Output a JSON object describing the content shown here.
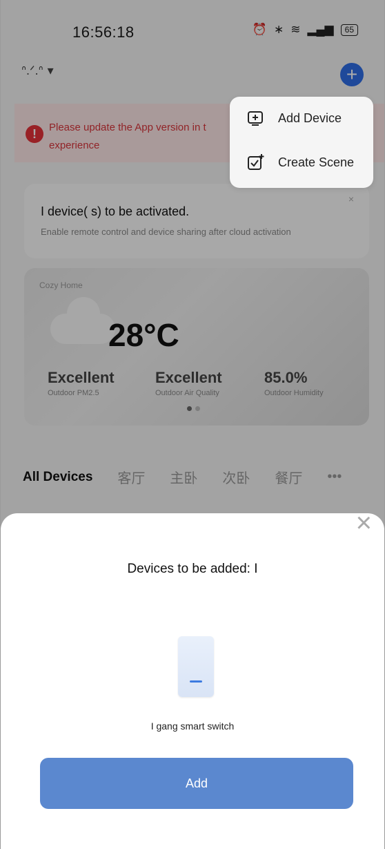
{
  "status_bar": {
    "time": "16:56:18",
    "battery": "65"
  },
  "header": {
    "home_name": "ᐢ.ᐟ.ᐢ"
  },
  "banner": {
    "text": "Please update the App version in t experience"
  },
  "activation_card": {
    "title": "I device( s)  to be activated.",
    "description": "Enable remote control and device sharing after cloud activation"
  },
  "weather": {
    "place": "Cozy Home",
    "temperature": "28°C",
    "metrics": [
      {
        "value": "Excellent",
        "label": "Outdoor PM2.5"
      },
      {
        "value": "Excellent",
        "label": "Outdoor Air Quality"
      },
      {
        "value": "85.0%",
        "label": "Outdoor Humidity"
      }
    ]
  },
  "tabs": [
    "All Devices",
    "客厅",
    "主卧",
    "次卧",
    "餐厅",
    "•••"
  ],
  "menu": {
    "items": [
      {
        "label": "Add Device",
        "icon": "add-device-icon"
      },
      {
        "label": "Create Scene",
        "icon": "create-scene-icon"
      }
    ]
  },
  "sheet": {
    "heading": "Devices to be added: I",
    "device_name": "I gang smart switch",
    "add_label": "Add"
  },
  "colors": {
    "accent": "#2f6ee6",
    "button": "#5b88cf",
    "warning": "#e5323a"
  }
}
